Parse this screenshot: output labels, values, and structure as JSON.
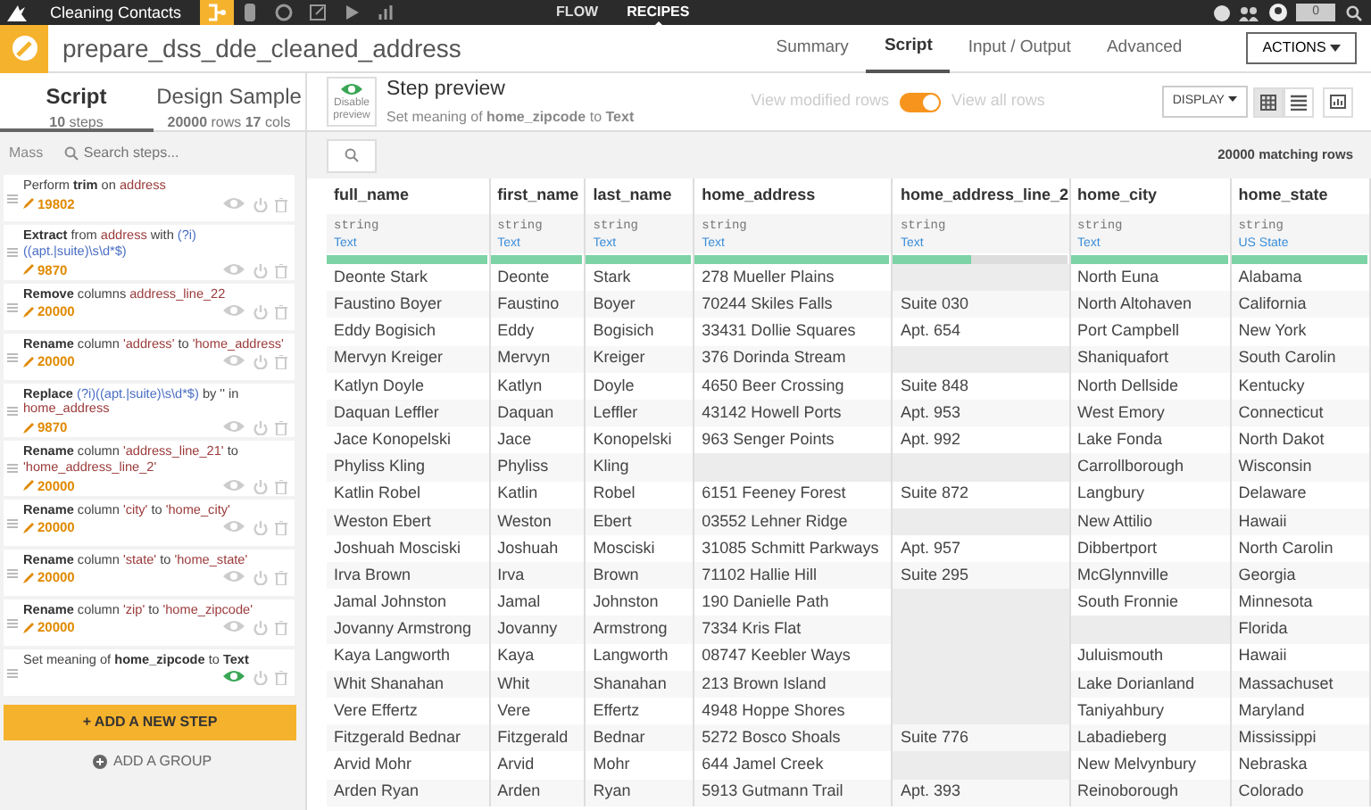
{
  "topbar": {
    "project": "Cleaning Contacts",
    "tools": [
      {
        "kind": "flow",
        "selected": true
      },
      {
        "kind": "database",
        "selected": false
      },
      {
        "kind": "circle",
        "selected": false
      },
      {
        "kind": "edit",
        "selected": false
      },
      {
        "kind": "play",
        "selected": false
      },
      {
        "kind": "chart",
        "selected": false
      }
    ],
    "nav": [
      {
        "label": "FLOW",
        "selected": false
      },
      {
        "label": "RECIPES",
        "selected": true
      }
    ],
    "notifications": "0"
  },
  "header": {
    "title": "prepare_dss_dde_cleaned_address",
    "tabs": [
      {
        "label": "Summary",
        "selected": false
      },
      {
        "label": "Script",
        "selected": true
      },
      {
        "label": "Input / Output",
        "selected": false
      },
      {
        "label": "Advanced",
        "selected": false
      }
    ],
    "actions": "ACTIONS"
  },
  "left_tabs": [
    {
      "title": "Script",
      "subtitle": "**10** steps",
      "selected": true
    },
    {
      "title": "Design Sample",
      "subtitle": "**20000** rows **17** cols",
      "selected": false
    }
  ],
  "mass": "Mass",
  "search_steps": {
    "placeholder": "Search steps..."
  },
  "steps": [
    {
      "segments": [
        {
          "kind": "plain",
          "text": "Perform "
        },
        {
          "kind": "keyword",
          "text": "trim"
        },
        {
          "kind": "plain",
          "text": " on "
        },
        {
          "kind": "column",
          "text": "address"
        }
      ],
      "count": "19802",
      "preview": false
    },
    {
      "segments": [
        {
          "kind": "keyword",
          "text": "Extract"
        },
        {
          "kind": "plain",
          "text": " from "
        },
        {
          "kind": "column",
          "text": "address"
        },
        {
          "kind": "plain",
          "text": " with "
        },
        {
          "kind": "pattern",
          "text": "(?i)((apt.|suite)\\s\\d*$)"
        }
      ],
      "count": "9870",
      "preview": false
    },
    {
      "segments": [
        {
          "kind": "keyword",
          "text": "Remove"
        },
        {
          "kind": "plain",
          "text": " columns "
        },
        {
          "kind": "column",
          "text": "address_line_22"
        }
      ],
      "count": "20000",
      "preview": false
    },
    {
      "segments": [
        {
          "kind": "keyword",
          "text": "Rename"
        },
        {
          "kind": "plain",
          "text": " column "
        },
        {
          "kind": "column",
          "text": "'address'"
        },
        {
          "kind": "plain",
          "text": " to "
        },
        {
          "kind": "column",
          "text": "'home_address'"
        }
      ],
      "count": "20000",
      "preview": false
    },
    {
      "segments": [
        {
          "kind": "keyword",
          "text": "Replace "
        },
        {
          "kind": "pattern",
          "text": "(?i)((apt.|suite)\\s\\d*$)"
        },
        {
          "kind": "plain",
          "text": " by '' in "
        },
        {
          "kind": "column",
          "text": "home_address"
        }
      ],
      "count": "9870",
      "preview": false
    },
    {
      "segments": [
        {
          "kind": "keyword",
          "text": "Rename"
        },
        {
          "kind": "plain",
          "text": " column "
        },
        {
          "kind": "column",
          "text": "'address_line_21'"
        },
        {
          "kind": "plain",
          "text": " to "
        },
        {
          "kind": "column",
          "text": "'home_address_line_2'"
        }
      ],
      "count": "20000",
      "preview": false
    },
    {
      "segments": [
        {
          "kind": "keyword",
          "text": "Rename"
        },
        {
          "kind": "plain",
          "text": " column "
        },
        {
          "kind": "column",
          "text": "'city'"
        },
        {
          "kind": "plain",
          "text": " to "
        },
        {
          "kind": "column",
          "text": "'home_city'"
        }
      ],
      "count": "20000",
      "preview": false
    },
    {
      "segments": [
        {
          "kind": "keyword",
          "text": "Rename"
        },
        {
          "kind": "plain",
          "text": " column "
        },
        {
          "kind": "column",
          "text": "'state'"
        },
        {
          "kind": "plain",
          "text": " to "
        },
        {
          "kind": "column",
          "text": "'home_state'"
        }
      ],
      "count": "20000",
      "preview": false
    },
    {
      "segments": [
        {
          "kind": "keyword",
          "text": "Rename"
        },
        {
          "kind": "plain",
          "text": " column "
        },
        {
          "kind": "column",
          "text": "'zip'"
        },
        {
          "kind": "plain",
          "text": " to "
        },
        {
          "kind": "column",
          "text": "'home_zipcode'"
        }
      ],
      "count": "20000",
      "preview": false
    },
    {
      "segments": [
        {
          "kind": "plain",
          "text": "Set meaning of "
        },
        {
          "kind": "keyword",
          "text": "home_zipcode"
        },
        {
          "kind": "plain",
          "text": " to "
        },
        {
          "kind": "keyword",
          "text": "Text"
        }
      ],
      "preview": true
    }
  ],
  "add_step": "+ ADD A NEW STEP",
  "add_group": "ADD A GROUP",
  "preview": {
    "disable_label": "Disable preview",
    "title": "Step preview",
    "subtitle": "Set meaning of **home_zipcode** to **Text**",
    "modified_label": "View modified rows",
    "toggle_on": true,
    "all_label": "View all rows",
    "display": "DISPLAY",
    "views": [
      {
        "kind": "grid",
        "selected": true
      },
      {
        "kind": "list",
        "selected": false
      }
    ]
  },
  "matching": "20000 matching rows",
  "table": {
    "columns": [
      {
        "name": "full_name",
        "storage": "string",
        "meaning": "Text",
        "level": 1
      },
      {
        "name": "first_name",
        "storage": "string",
        "meaning": "Text",
        "level": 1
      },
      {
        "name": "last_name",
        "storage": "string",
        "meaning": "Text",
        "level": 1
      },
      {
        "name": "home_address",
        "storage": "string",
        "meaning": "Text",
        "level": 1
      },
      {
        "name": "home_address_line_2",
        "storage": "string",
        "meaning": "Text",
        "level": 0.45
      },
      {
        "name": "home_city",
        "storage": "string",
        "meaning": "Text",
        "level": 1
      },
      {
        "name": "home_state",
        "storage": "string",
        "meaning": "US State",
        "level": 1
      }
    ],
    "rows": [
      [
        "Deonte Stark",
        "Deonte",
        "Stark",
        "278 Mueller Plains",
        null,
        "North Euna",
        "Alabama"
      ],
      [
        "Faustino Boyer",
        "Faustino",
        "Boyer",
        "70244 Skiles Falls",
        "Suite 030",
        "North Altohaven",
        "California"
      ],
      [
        "Eddy Bogisich",
        "Eddy",
        "Bogisich",
        "33431 Dollie Squares",
        "Apt. 654",
        "Port Campbell",
        "New York"
      ],
      [
        "Mervyn Kreiger",
        "Mervyn",
        "Kreiger",
        "376 Dorinda Stream",
        null,
        "Shaniquafort",
        "South Carolin"
      ],
      [
        "Katlyn Doyle",
        "Katlyn",
        "Doyle",
        "4650 Beer Crossing",
        "Suite 848",
        "North Dellside",
        "Kentucky"
      ],
      [
        "Daquan Leffler",
        "Daquan",
        "Leffler",
        "43142 Howell Ports",
        "Apt. 953",
        "West Emory",
        "Connecticut"
      ],
      [
        "Jace Konopelski",
        "Jace",
        "Konopelski",
        "963 Senger Points",
        "Apt. 992",
        "Lake Fonda",
        "North Dakot"
      ],
      [
        "Phyliss Kling",
        "Phyliss",
        "Kling",
        null,
        null,
        "Carrollborough",
        "Wisconsin"
      ],
      [
        "Katlin Robel",
        "Katlin",
        "Robel",
        "6151 Feeney Forest",
        "Suite 872",
        "Langbury",
        "Delaware"
      ],
      [
        "Weston Ebert",
        "Weston",
        "Ebert",
        "03552 Lehner Ridge",
        null,
        "New Attilio",
        "Hawaii"
      ],
      [
        "Joshuah Mosciski",
        "Joshuah",
        "Mosciski",
        "31085 Schmitt Parkways",
        "Apt. 957",
        "Dibbertport",
        "North Carolin"
      ],
      [
        "Irva Brown",
        "Irva",
        "Brown",
        "71102 Hallie Hill",
        "Suite 295",
        "McGlynnville",
        "Georgia"
      ],
      [
        "Jamal Johnston",
        "Jamal",
        "Johnston",
        "190 Danielle Path",
        null,
        "South Fronnie",
        "Minnesota"
      ],
      [
        "Jovanny Armstrong",
        "Jovanny",
        "Armstrong",
        "7334 Kris Flat",
        null,
        null,
        "Florida"
      ],
      [
        "Kaya Langworth",
        "Kaya",
        "Langworth",
        "08747 Keebler Ways",
        null,
        "Juluismouth",
        "Hawaii"
      ],
      [
        "Whit Shanahan",
        "Whit",
        "Shanahan",
        "213 Brown Island",
        null,
        "Lake Dorianland",
        "Massachuset"
      ],
      [
        "Vere Effertz",
        "Vere",
        "Effertz",
        "4948 Hoppe Shores",
        null,
        "Taniyahbury",
        "Maryland"
      ],
      [
        "Fitzgerald Bednar",
        "Fitzgerald",
        "Bednar",
        "5272 Bosco Shoals",
        "Suite 776",
        "Labadieberg",
        "Mississippi"
      ],
      [
        "Arvid Mohr",
        "Arvid",
        "Mohr",
        "644 Jamel Creek",
        null,
        "New Melvynbury",
        "Nebraska"
      ],
      [
        "Arden Ryan",
        "Arden",
        "Ryan",
        "5913 Gutmann Trail",
        "Apt. 393",
        "Reinoborough",
        "Colorado"
      ]
    ]
  }
}
